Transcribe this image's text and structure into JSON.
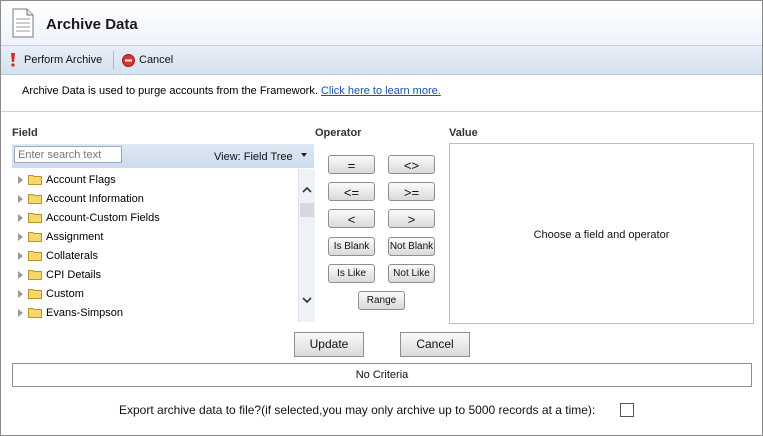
{
  "header": {
    "title": "Archive Data",
    "icon": "document-icon"
  },
  "toolbar": {
    "perform_archive": "Perform Archive",
    "cancel": "Cancel"
  },
  "info": {
    "text": "Archive Data is used to purge accounts from the Framework.",
    "link": "Click here to learn more."
  },
  "field_panel": {
    "label": "Field",
    "search_placeholder": "Enter search text",
    "view_label": "View: Field Tree",
    "items": [
      {
        "label": "Account Flags"
      },
      {
        "label": "Account Information"
      },
      {
        "label": "Account-Custom Fields"
      },
      {
        "label": "Assignment"
      },
      {
        "label": "Collaterals"
      },
      {
        "label": "CPI Details"
      },
      {
        "label": "Custom"
      },
      {
        "label": "Evans-Simpson"
      }
    ]
  },
  "operator_panel": {
    "label": "Operator",
    "ops": {
      "eq": "=",
      "ne": "<>",
      "le": "<=",
      "ge": ">=",
      "lt": "<",
      "gt": ">",
      "is_blank": "Is Blank",
      "not_blank": "Not Blank",
      "is_like": "Is Like",
      "not_like": "Not Like",
      "range": "Range"
    }
  },
  "value_panel": {
    "label": "Value",
    "placeholder": "Choose a field and operator"
  },
  "actions": {
    "update": "Update",
    "cancel": "Cancel"
  },
  "criteria": {
    "text": "No Criteria"
  },
  "export": {
    "text": "Export archive data to file?(if selected,you may only archive up to 5000 records at a time):",
    "checked": false
  },
  "colors": {
    "toolbar_bg": "#d6e1ef",
    "link": "#1a4fb0",
    "cancel_icon": "#d9342b"
  }
}
